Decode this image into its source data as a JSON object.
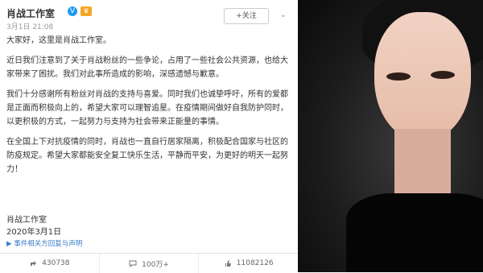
{
  "post": {
    "username": "肖战工作室",
    "verified_badge": "V",
    "timestamp": "3月1日 21:08",
    "follow_label": "+关注",
    "more_label": "⌄",
    "paragraphs": [
      "大家好，这里是肖战工作室。",
      "近日我们注意到了关于肖战粉丝的一些争论，占用了一些社会公共资源，也给大家带来了困扰。我们对此事所造成的影响，深感遗憾与歉意。",
      "我们十分感谢所有粉丝对肖战的支持与喜爱。同时我们也诚挚呼吁，所有的爱都是正面而积极向上的，希望大家可以理智追星。在疫情期间做好自我防护同时，以更积极的方式，一起努力与支持为社会带来正能量的事情。",
      "在全国上下对抗疫情的同时，肖战也一直自行居家隔离，积极配合国家与社区的防疫规定。希望大家都能安全复工快乐生活，平静而平安，为更好的明天一起努力！"
    ],
    "signature_name": "肖战工作室",
    "signature_date": "2020年3月1日",
    "topic_tag": "事件相关方回复与声明"
  },
  "footer": {
    "share_count": "430738",
    "comment_count": "100万+",
    "like_count": "11082126"
  },
  "photo": {
    "subject": "portrait"
  },
  "colors": {
    "link": "#3b7ecb",
    "verified": "#1d9bf0",
    "crown": "#f5a623"
  },
  "icons": {
    "share": "share-icon",
    "comment": "comment-icon",
    "like": "like-icon"
  }
}
